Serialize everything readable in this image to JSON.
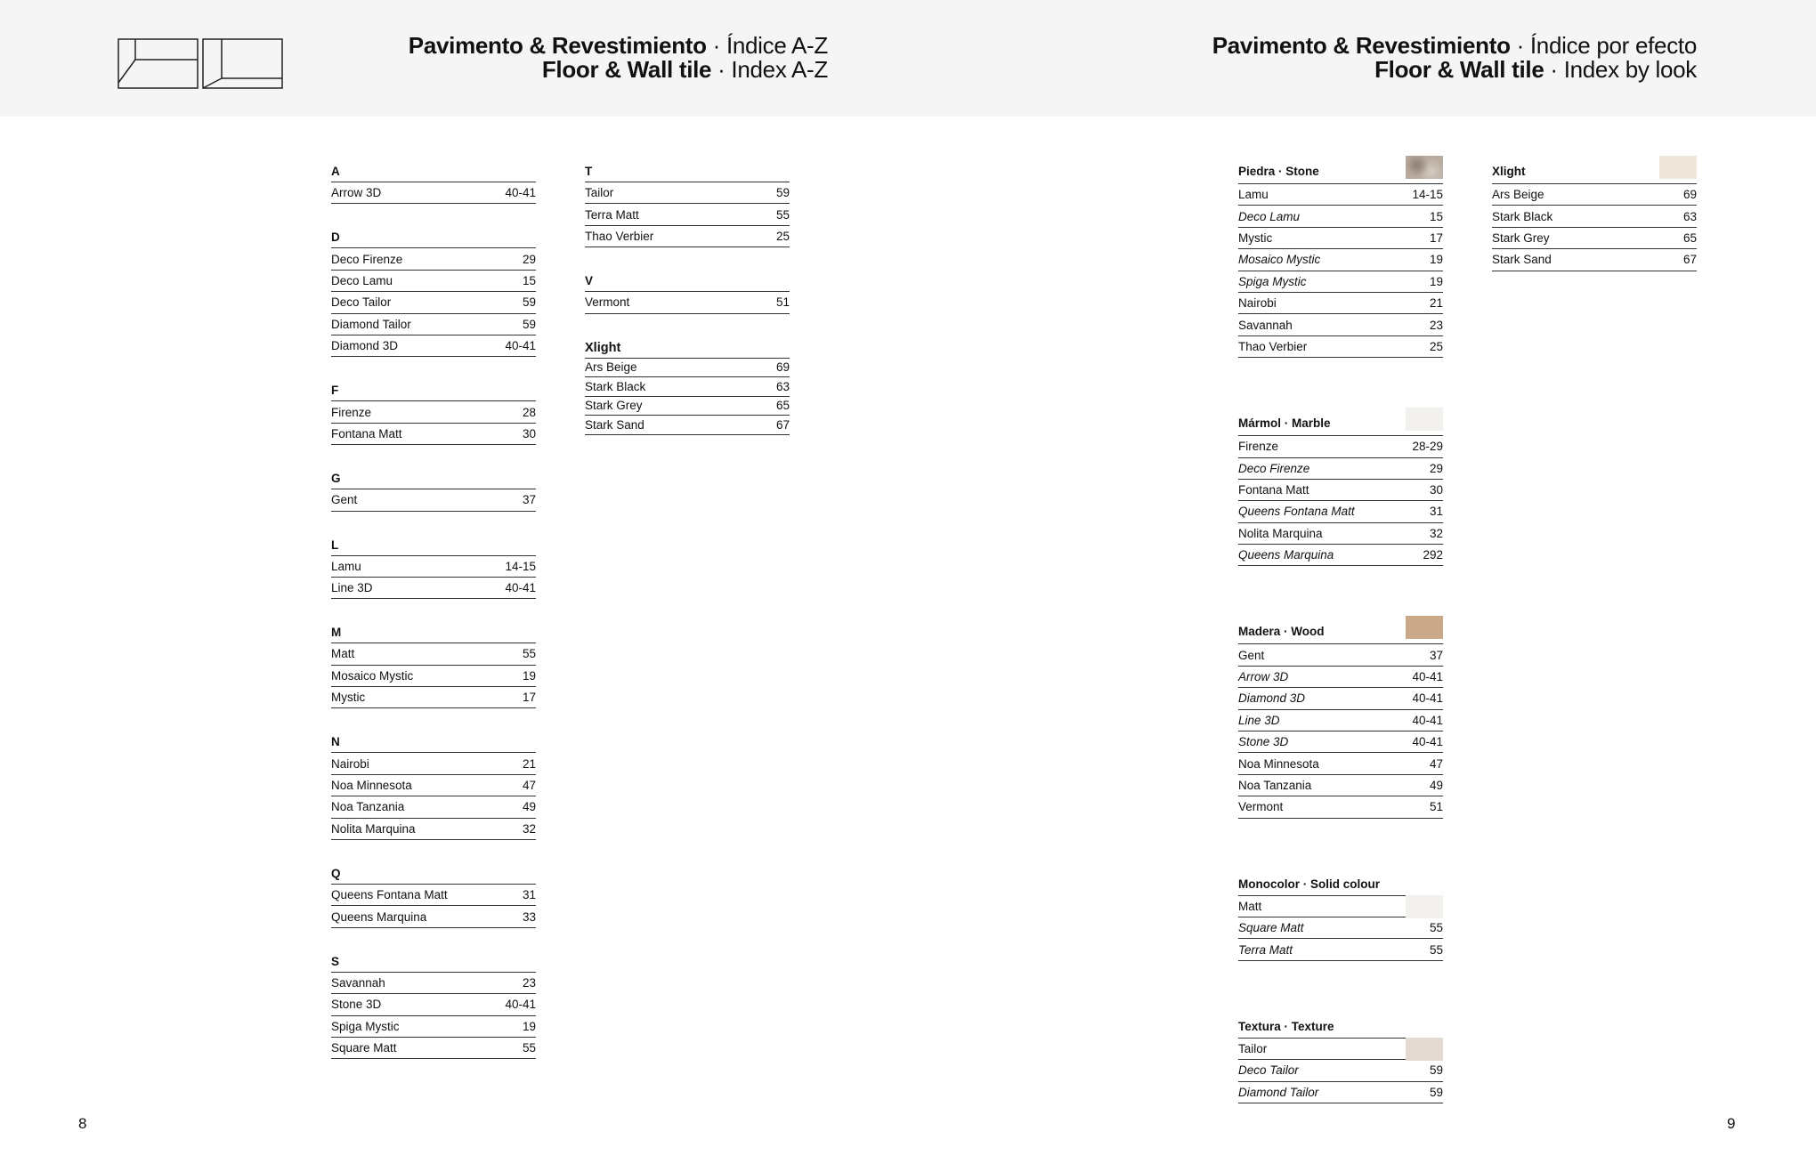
{
  "header": {
    "left": {
      "line1_bold": "Pavimento & Revestimiento",
      "line1_light": " · Índice A-Z",
      "line2_bold": "Floor & Wall tile",
      "line2_light": " · Index A-Z"
    },
    "right": {
      "line1_bold": "Pavimento & Revestimiento",
      "line1_light": " · Índice por efecto",
      "line2_bold": "Floor & Wall tile",
      "line2_light": " · Index by look"
    }
  },
  "az_index": {
    "columns": [
      [
        {
          "letter": "A",
          "items": [
            [
              "Arrow 3D",
              "40-41"
            ]
          ]
        },
        {
          "letter": "D",
          "items": [
            [
              "Deco Firenze",
              "29"
            ],
            [
              "Deco Lamu",
              "15"
            ],
            [
              "Deco Tailor",
              "59"
            ],
            [
              "Diamond Tailor",
              "59"
            ],
            [
              "Diamond 3D",
              "40-41"
            ]
          ]
        },
        {
          "letter": "F",
          "items": [
            [
              "Firenze",
              "28"
            ],
            [
              "Fontana Matt",
              "30"
            ]
          ]
        },
        {
          "letter": "G",
          "items": [
            [
              "Gent",
              "37"
            ]
          ]
        },
        {
          "letter": "L",
          "items": [
            [
              "Lamu",
              "14-15"
            ],
            [
              "Line 3D",
              "40-41"
            ]
          ]
        },
        {
          "letter": "M",
          "items": [
            [
              "Matt",
              "55"
            ],
            [
              "Mosaico Mystic",
              "19"
            ],
            [
              "Mystic",
              "17"
            ]
          ]
        },
        {
          "letter": "N",
          "items": [
            [
              "Nairobi",
              "21"
            ],
            [
              "Noa Minnesota",
              "47"
            ],
            [
              "Noa Tanzania",
              "49"
            ],
            [
              "Nolita Marquina",
              "32"
            ]
          ]
        },
        {
          "letter": "Q",
          "items": [
            [
              "Queens Fontana Matt",
              "31"
            ],
            [
              "Queens Marquina",
              "33"
            ]
          ]
        },
        {
          "letter": "S",
          "items": [
            [
              "Savannah",
              "23"
            ],
            [
              "Stone 3D",
              "40-41"
            ],
            [
              "Spiga Mystic",
              "19"
            ],
            [
              "Square Matt",
              "55"
            ]
          ]
        }
      ],
      [
        {
          "letter": "T",
          "items": [
            [
              "Tailor",
              "59"
            ],
            [
              "Terra Matt",
              "55"
            ],
            [
              "Thao Verbier",
              "25"
            ]
          ]
        },
        {
          "letter": "V",
          "items": [
            [
              "Vermont",
              "51"
            ]
          ]
        },
        {
          "letter": "Xlight",
          "xlight": true,
          "items": [
            [
              "Ars Beige",
              "69"
            ],
            [
              "Stark Black",
              "63"
            ],
            [
              "Stark Grey",
              "65"
            ],
            [
              "Stark Sand",
              "67"
            ]
          ]
        }
      ]
    ]
  },
  "look_index": {
    "columns": [
      [
        {
          "title": "Piedra · Stone",
          "swatch": "#b9ab9f",
          "items": [
            [
              "Lamu",
              "14-15",
              false
            ],
            [
              "Deco Lamu",
              "15",
              true
            ],
            [
              "Mystic",
              "17",
              false
            ],
            [
              "Mosaico Mystic",
              "19",
              true
            ],
            [
              "Spiga Mystic",
              "19",
              true
            ],
            [
              "Nairobi",
              "21",
              false
            ],
            [
              "Savannah",
              "23",
              false
            ],
            [
              "Thao Verbier",
              "25",
              false
            ]
          ]
        },
        {
          "title": "Mármol · Marble",
          "swatch": "#f3f1ed",
          "items": [
            [
              "Firenze",
              "28-29",
              false
            ],
            [
              "Deco Firenze",
              "29",
              true
            ],
            [
              "Fontana Matt",
              "30",
              false
            ],
            [
              "Queens Fontana Matt",
              "31",
              true
            ],
            [
              "Nolita Marquina",
              "32",
              false
            ],
            [
              "Queens Marquina",
              "292",
              true
            ]
          ]
        },
        {
          "title": "Madera · Wood",
          "swatch": "#caa988",
          "items": [
            [
              "Gent",
              "37",
              false
            ],
            [
              "Arrow 3D",
              "40-41",
              true
            ],
            [
              "Diamond 3D",
              "40-41",
              true
            ],
            [
              "Line 3D",
              "40-41",
              true
            ],
            [
              "Stone 3D",
              "40-41",
              true
            ],
            [
              "Noa Minnesota",
              "47",
              false
            ],
            [
              "Noa Tanzania",
              "49",
              false
            ],
            [
              "Vermont",
              "51",
              false
            ]
          ]
        },
        {
          "title": "Monocolor · Solid colour",
          "swatch": "#f1f0ec",
          "short": true,
          "items": [
            [
              "Matt",
              "",
              false
            ],
            [
              "Square Matt",
              "55",
              true
            ],
            [
              "Terra Matt",
              "55",
              true
            ]
          ]
        },
        {
          "title": "Textura · Texture",
          "swatch": "#e2dad1",
          "short": true,
          "items": [
            [
              "Tailor",
              "",
              false
            ],
            [
              "Deco Tailor",
              "59",
              true
            ],
            [
              "Diamond Tailor",
              "59",
              true
            ]
          ]
        }
      ],
      [
        {
          "title": "Xlight",
          "swatch": "#efe7dc",
          "items": [
            [
              "Ars Beige",
              "69",
              false
            ],
            [
              "Stark Black",
              "63",
              false
            ],
            [
              "Stark Grey",
              "65",
              false
            ],
            [
              "Stark Sand",
              "67",
              false
            ]
          ]
        }
      ]
    ]
  },
  "page_numbers": {
    "left": "8",
    "right": "9"
  }
}
